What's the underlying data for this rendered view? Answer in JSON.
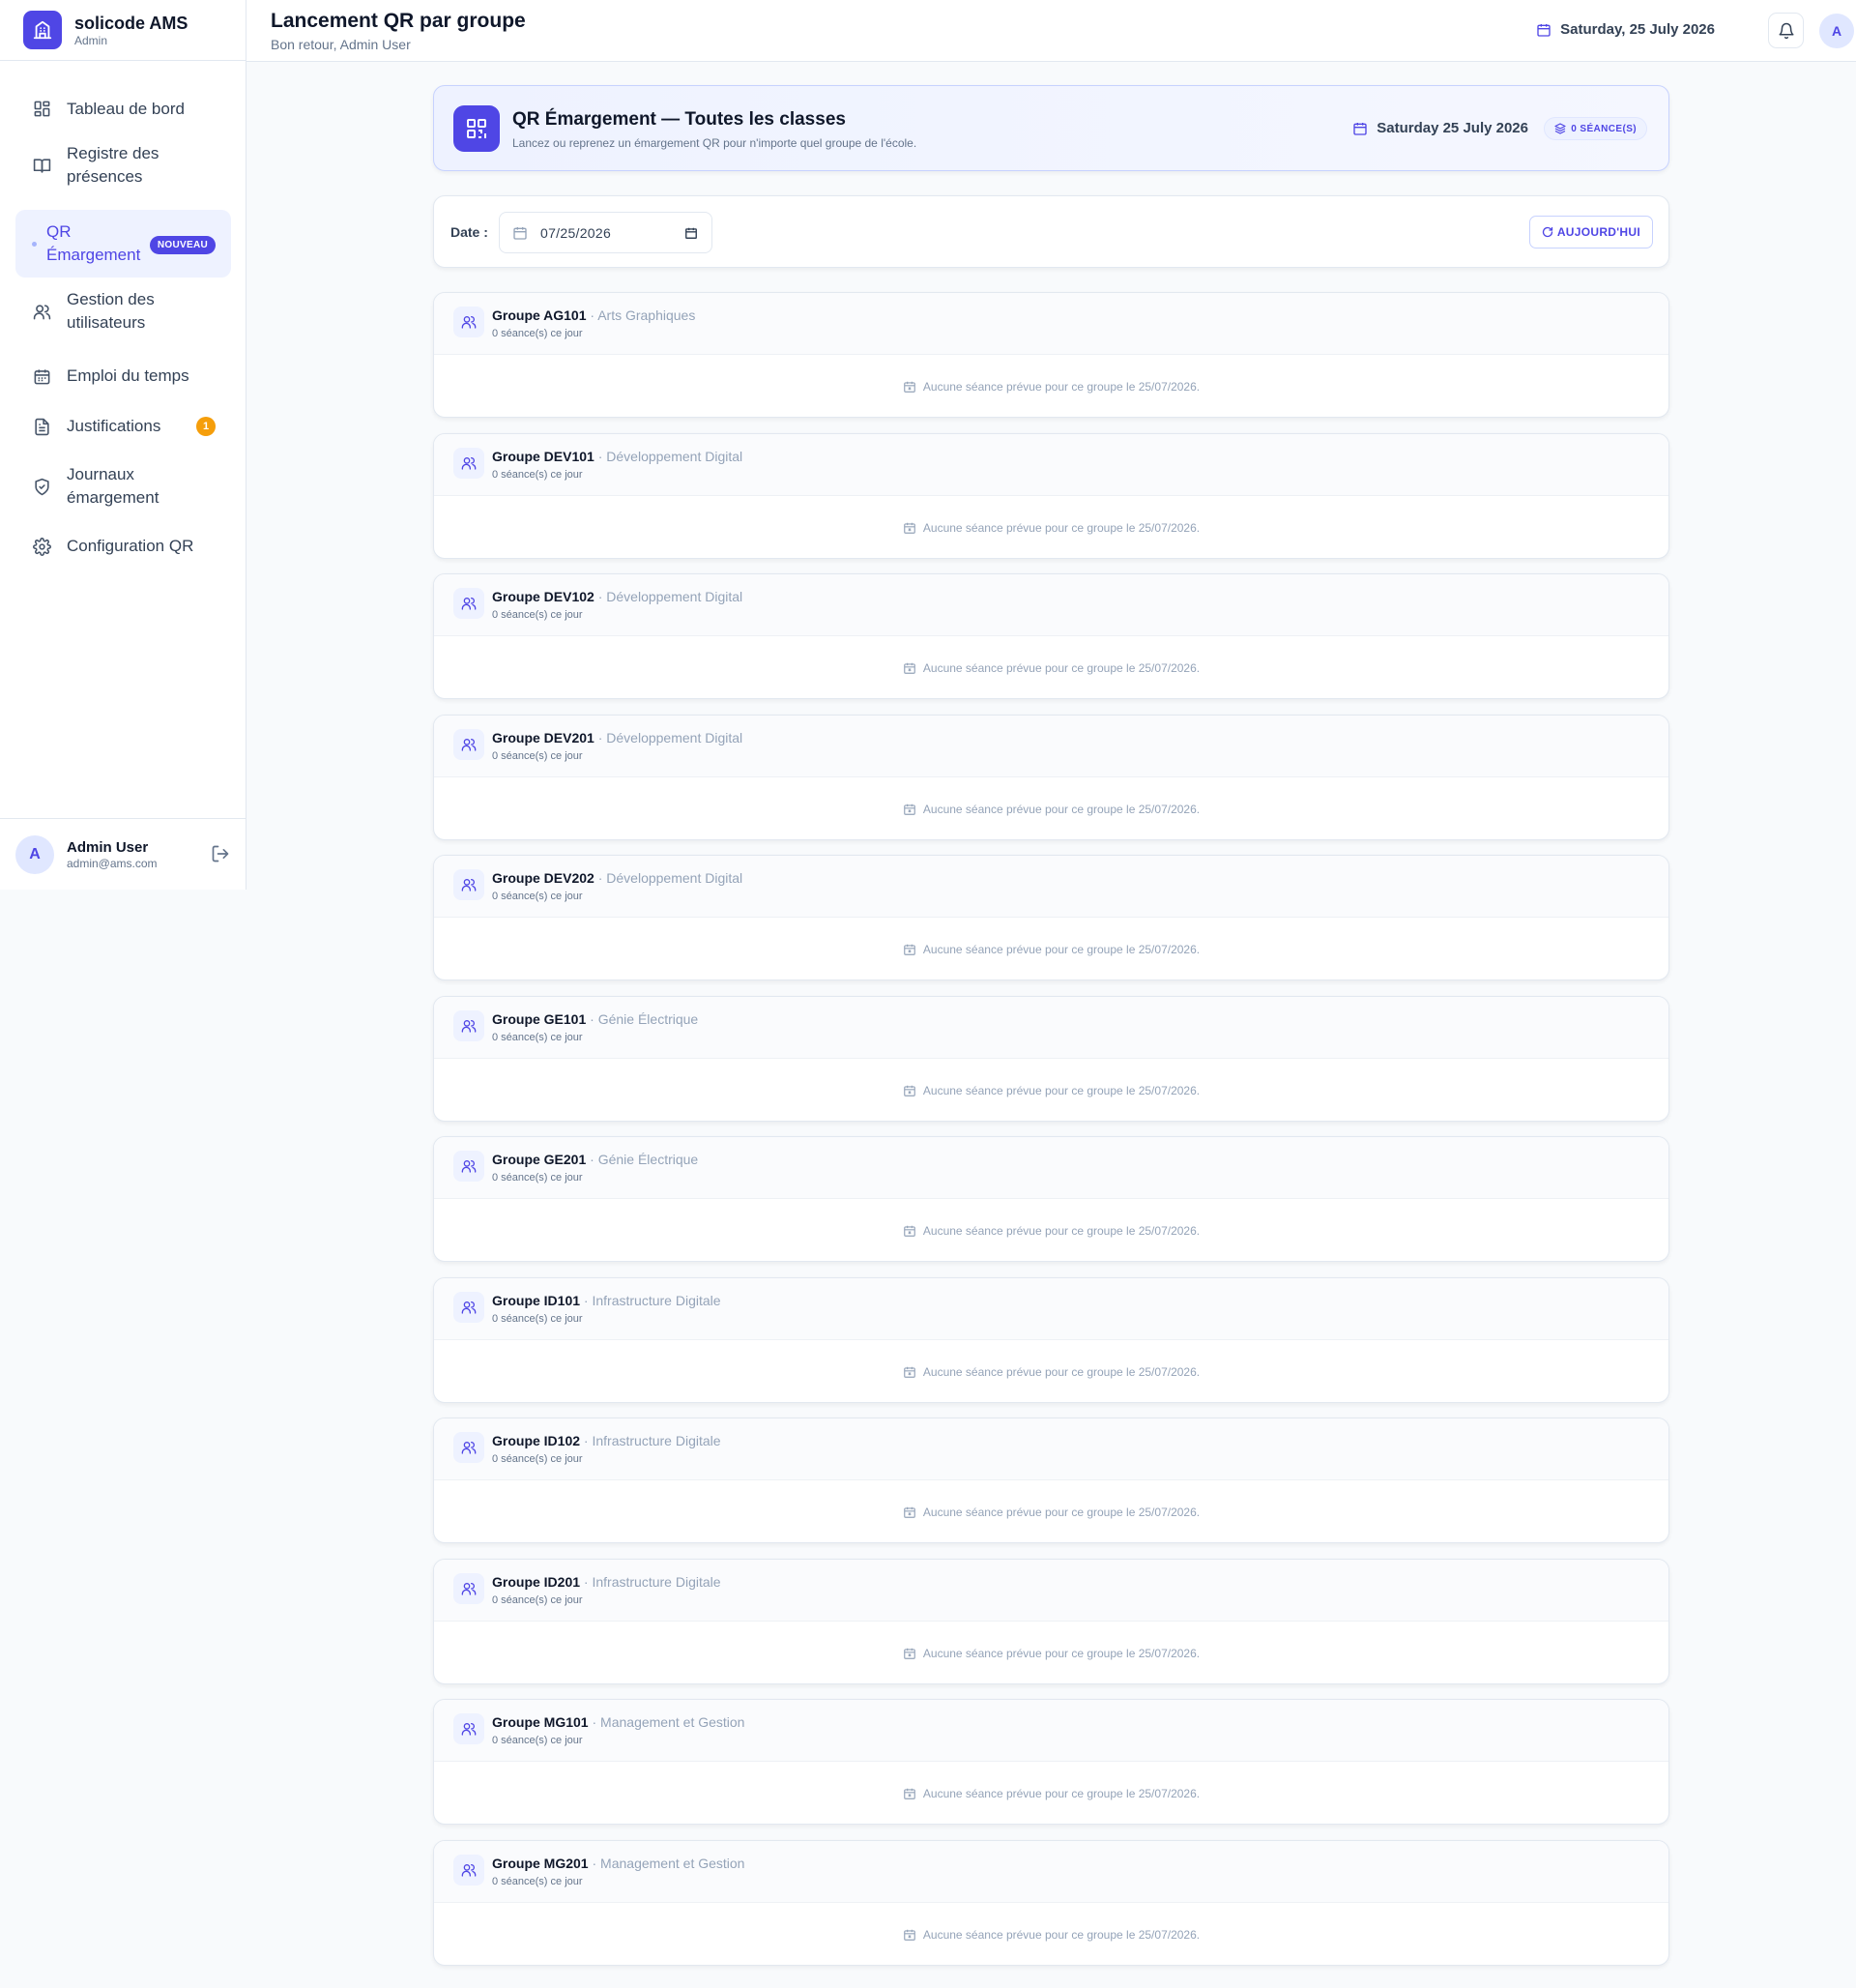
{
  "brand": {
    "name": "solicode AMS",
    "role": "Admin"
  },
  "sidebar": {
    "items": [
      {
        "label": "Tableau de bord",
        "icon": "dashboard-icon"
      },
      {
        "label": "Registre des présences",
        "icon": "book-icon"
      },
      {
        "label": "QR Émargement",
        "icon": "dot-icon",
        "badge": "NOUVEAU",
        "active": true
      },
      {
        "label": "Gestion des utilisateurs",
        "icon": "users-icon"
      },
      {
        "label": "Emploi du temps",
        "icon": "calendar-icon"
      },
      {
        "label": "Justifications",
        "icon": "file-icon",
        "badge": "1"
      },
      {
        "label": "Journaux émargement",
        "icon": "shield-icon"
      },
      {
        "label": "Configuration QR",
        "icon": "gear-icon"
      }
    ],
    "user": {
      "initial": "A",
      "name": "Admin User",
      "email": "admin@ams.com"
    }
  },
  "header": {
    "title": "Lancement QR par groupe",
    "subtitle": "Bon retour, Admin User",
    "date": "Saturday, 25 July 2026",
    "avatar": "A"
  },
  "hero": {
    "title": "QR Émargement — Toutes les classes",
    "description": "Lancez ou reprenez un émargement QR pour n'importe quel groupe de l'école.",
    "date": "Saturday 25 July 2026",
    "sessions": "0 SÉANCE(S)"
  },
  "filter": {
    "label": "Date :",
    "value": "07/25/2026",
    "today_button": "AUJOURD'HUI"
  },
  "groups": [
    {
      "code": "Groupe AG101",
      "field": "Arts Graphiques",
      "count": "0 séance(s) ce jour",
      "empty": "Aucune séance prévue pour ce groupe le 25/07/2026."
    },
    {
      "code": "Groupe DEV101",
      "field": "Développement Digital",
      "count": "0 séance(s) ce jour",
      "empty": "Aucune séance prévue pour ce groupe le 25/07/2026."
    },
    {
      "code": "Groupe DEV102",
      "field": "Développement Digital",
      "count": "0 séance(s) ce jour",
      "empty": "Aucune séance prévue pour ce groupe le 25/07/2026."
    },
    {
      "code": "Groupe DEV201",
      "field": "Développement Digital",
      "count": "0 séance(s) ce jour",
      "empty": "Aucune séance prévue pour ce groupe le 25/07/2026."
    },
    {
      "code": "Groupe DEV202",
      "field": "Développement Digital",
      "count": "0 séance(s) ce jour",
      "empty": "Aucune séance prévue pour ce groupe le 25/07/2026."
    },
    {
      "code": "Groupe GE101",
      "field": "Génie Électrique",
      "count": "0 séance(s) ce jour",
      "empty": "Aucune séance prévue pour ce groupe le 25/07/2026."
    },
    {
      "code": "Groupe GE201",
      "field": "Génie Électrique",
      "count": "0 séance(s) ce jour",
      "empty": "Aucune séance prévue pour ce groupe le 25/07/2026."
    },
    {
      "code": "Groupe ID101",
      "field": "Infrastructure Digitale",
      "count": "0 séance(s) ce jour",
      "empty": "Aucune séance prévue pour ce groupe le 25/07/2026."
    },
    {
      "code": "Groupe ID102",
      "field": "Infrastructure Digitale",
      "count": "0 séance(s) ce jour",
      "empty": "Aucune séance prévue pour ce groupe le 25/07/2026."
    },
    {
      "code": "Groupe ID201",
      "field": "Infrastructure Digitale",
      "count": "0 séance(s) ce jour",
      "empty": "Aucune séance prévue pour ce groupe le 25/07/2026."
    },
    {
      "code": "Groupe MG101",
      "field": "Management et Gestion",
      "count": "0 séance(s) ce jour",
      "empty": "Aucune séance prévue pour ce groupe le 25/07/2026."
    },
    {
      "code": "Groupe MG201",
      "field": "Management et Gestion",
      "count": "0 séance(s) ce jour",
      "empty": "Aucune séance prévue pour ce groupe le 25/07/2026."
    }
  ],
  "colors": {
    "accent": "#4f46e5",
    "badge_warning": "#f59e0b",
    "hero_bg": "#eef2ff"
  }
}
